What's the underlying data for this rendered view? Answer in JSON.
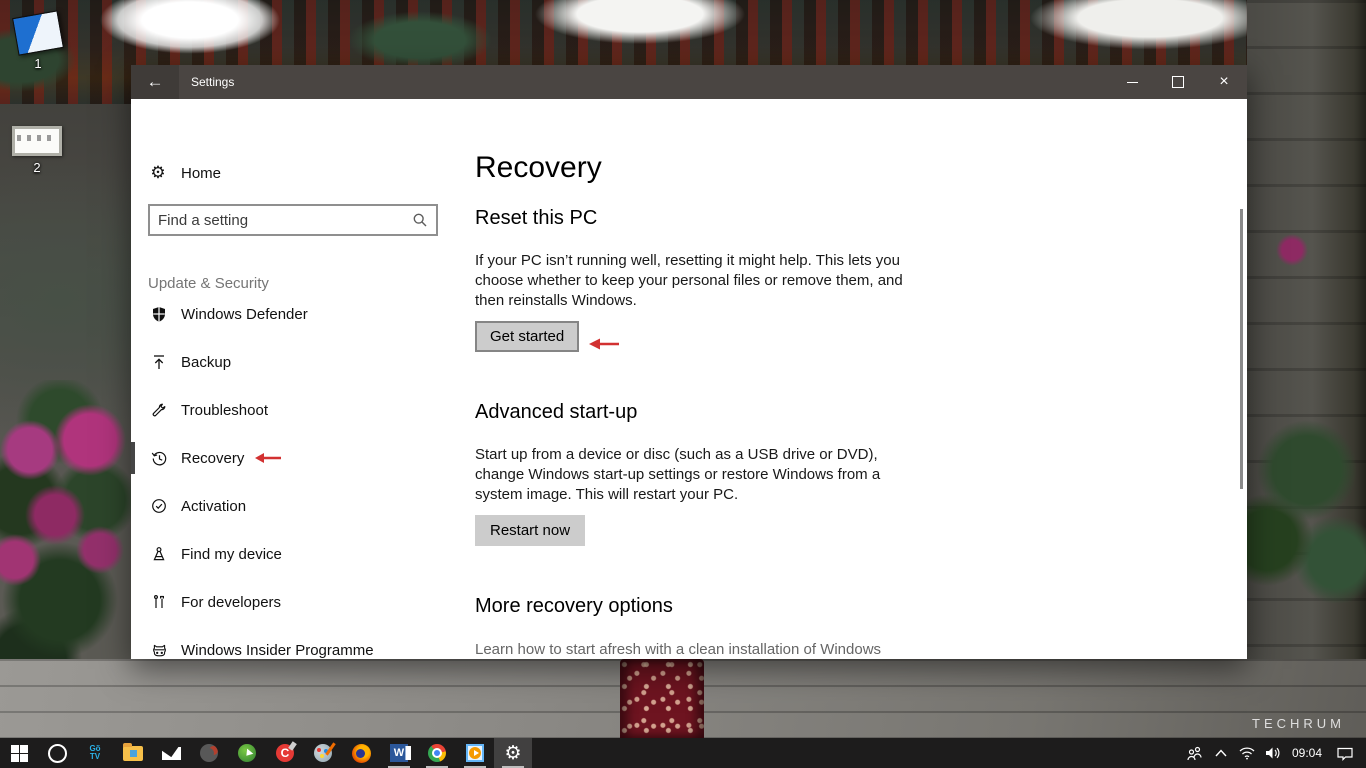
{
  "desktop": {
    "icons": [
      {
        "label": "1"
      },
      {
        "label": "2"
      }
    ],
    "watermark": "TECHRUM"
  },
  "window": {
    "titlebar": {
      "title": "Settings",
      "back_glyph": "←",
      "close_glyph": "×",
      "color": "#4a4542"
    },
    "sidebar": {
      "home_label": "Home",
      "search_placeholder": "Find a setting",
      "section_header": "Update & Security",
      "items": [
        {
          "label": "Windows Defender",
          "icon": "shield"
        },
        {
          "label": "Backup",
          "icon": "upload-arrow"
        },
        {
          "label": "Troubleshoot",
          "icon": "wrench"
        },
        {
          "label": "Recovery",
          "icon": "history",
          "selected": true
        },
        {
          "label": "Activation",
          "icon": "check-circle"
        },
        {
          "label": "Find my device",
          "icon": "map-marker"
        },
        {
          "label": "For developers",
          "icon": "dev-tools"
        },
        {
          "label": "Windows Insider Programme",
          "icon": "ninja-cat"
        }
      ]
    },
    "main": {
      "page_title": "Recovery",
      "reset": {
        "heading": "Reset this PC",
        "body": "If your PC isn’t running well, resetting it might help. This lets you choose whether to keep your personal files or remove them, and then reinstalls Windows.",
        "button_label": "Get started"
      },
      "advanced": {
        "heading": "Advanced start-up",
        "body": "Start up from a device or disc (such as a USB drive or DVD), change Windows start-up settings or restore Windows from a system image. This will restart your PC.",
        "button_label": "Restart now"
      },
      "more": {
        "heading": "More recovery options",
        "link_label": "Learn how to start afresh with a clean installation of Windows"
      }
    },
    "annotation_color": "#d23131"
  },
  "taskbar": {
    "time": "09:04",
    "icon_text": {
      "gotv_line1": "Gõ",
      "gotv_line2": "TV",
      "word_letter": "W",
      "ccleaner_letter": "C",
      "gear_glyph": "⚙",
      "home_gear_glyph": "⚙"
    },
    "app_icons": [
      "start",
      "cortana",
      "go-tv",
      "file-explorer",
      "mail",
      "downloader",
      "idm",
      "ccleaner",
      "paint",
      "firefox",
      "word",
      "chrome",
      "media-player",
      "settings"
    ],
    "tray_icons": [
      "people",
      "chevron-up",
      "wifi",
      "volume",
      "action-center"
    ],
    "color": "#1d1c1c"
  }
}
